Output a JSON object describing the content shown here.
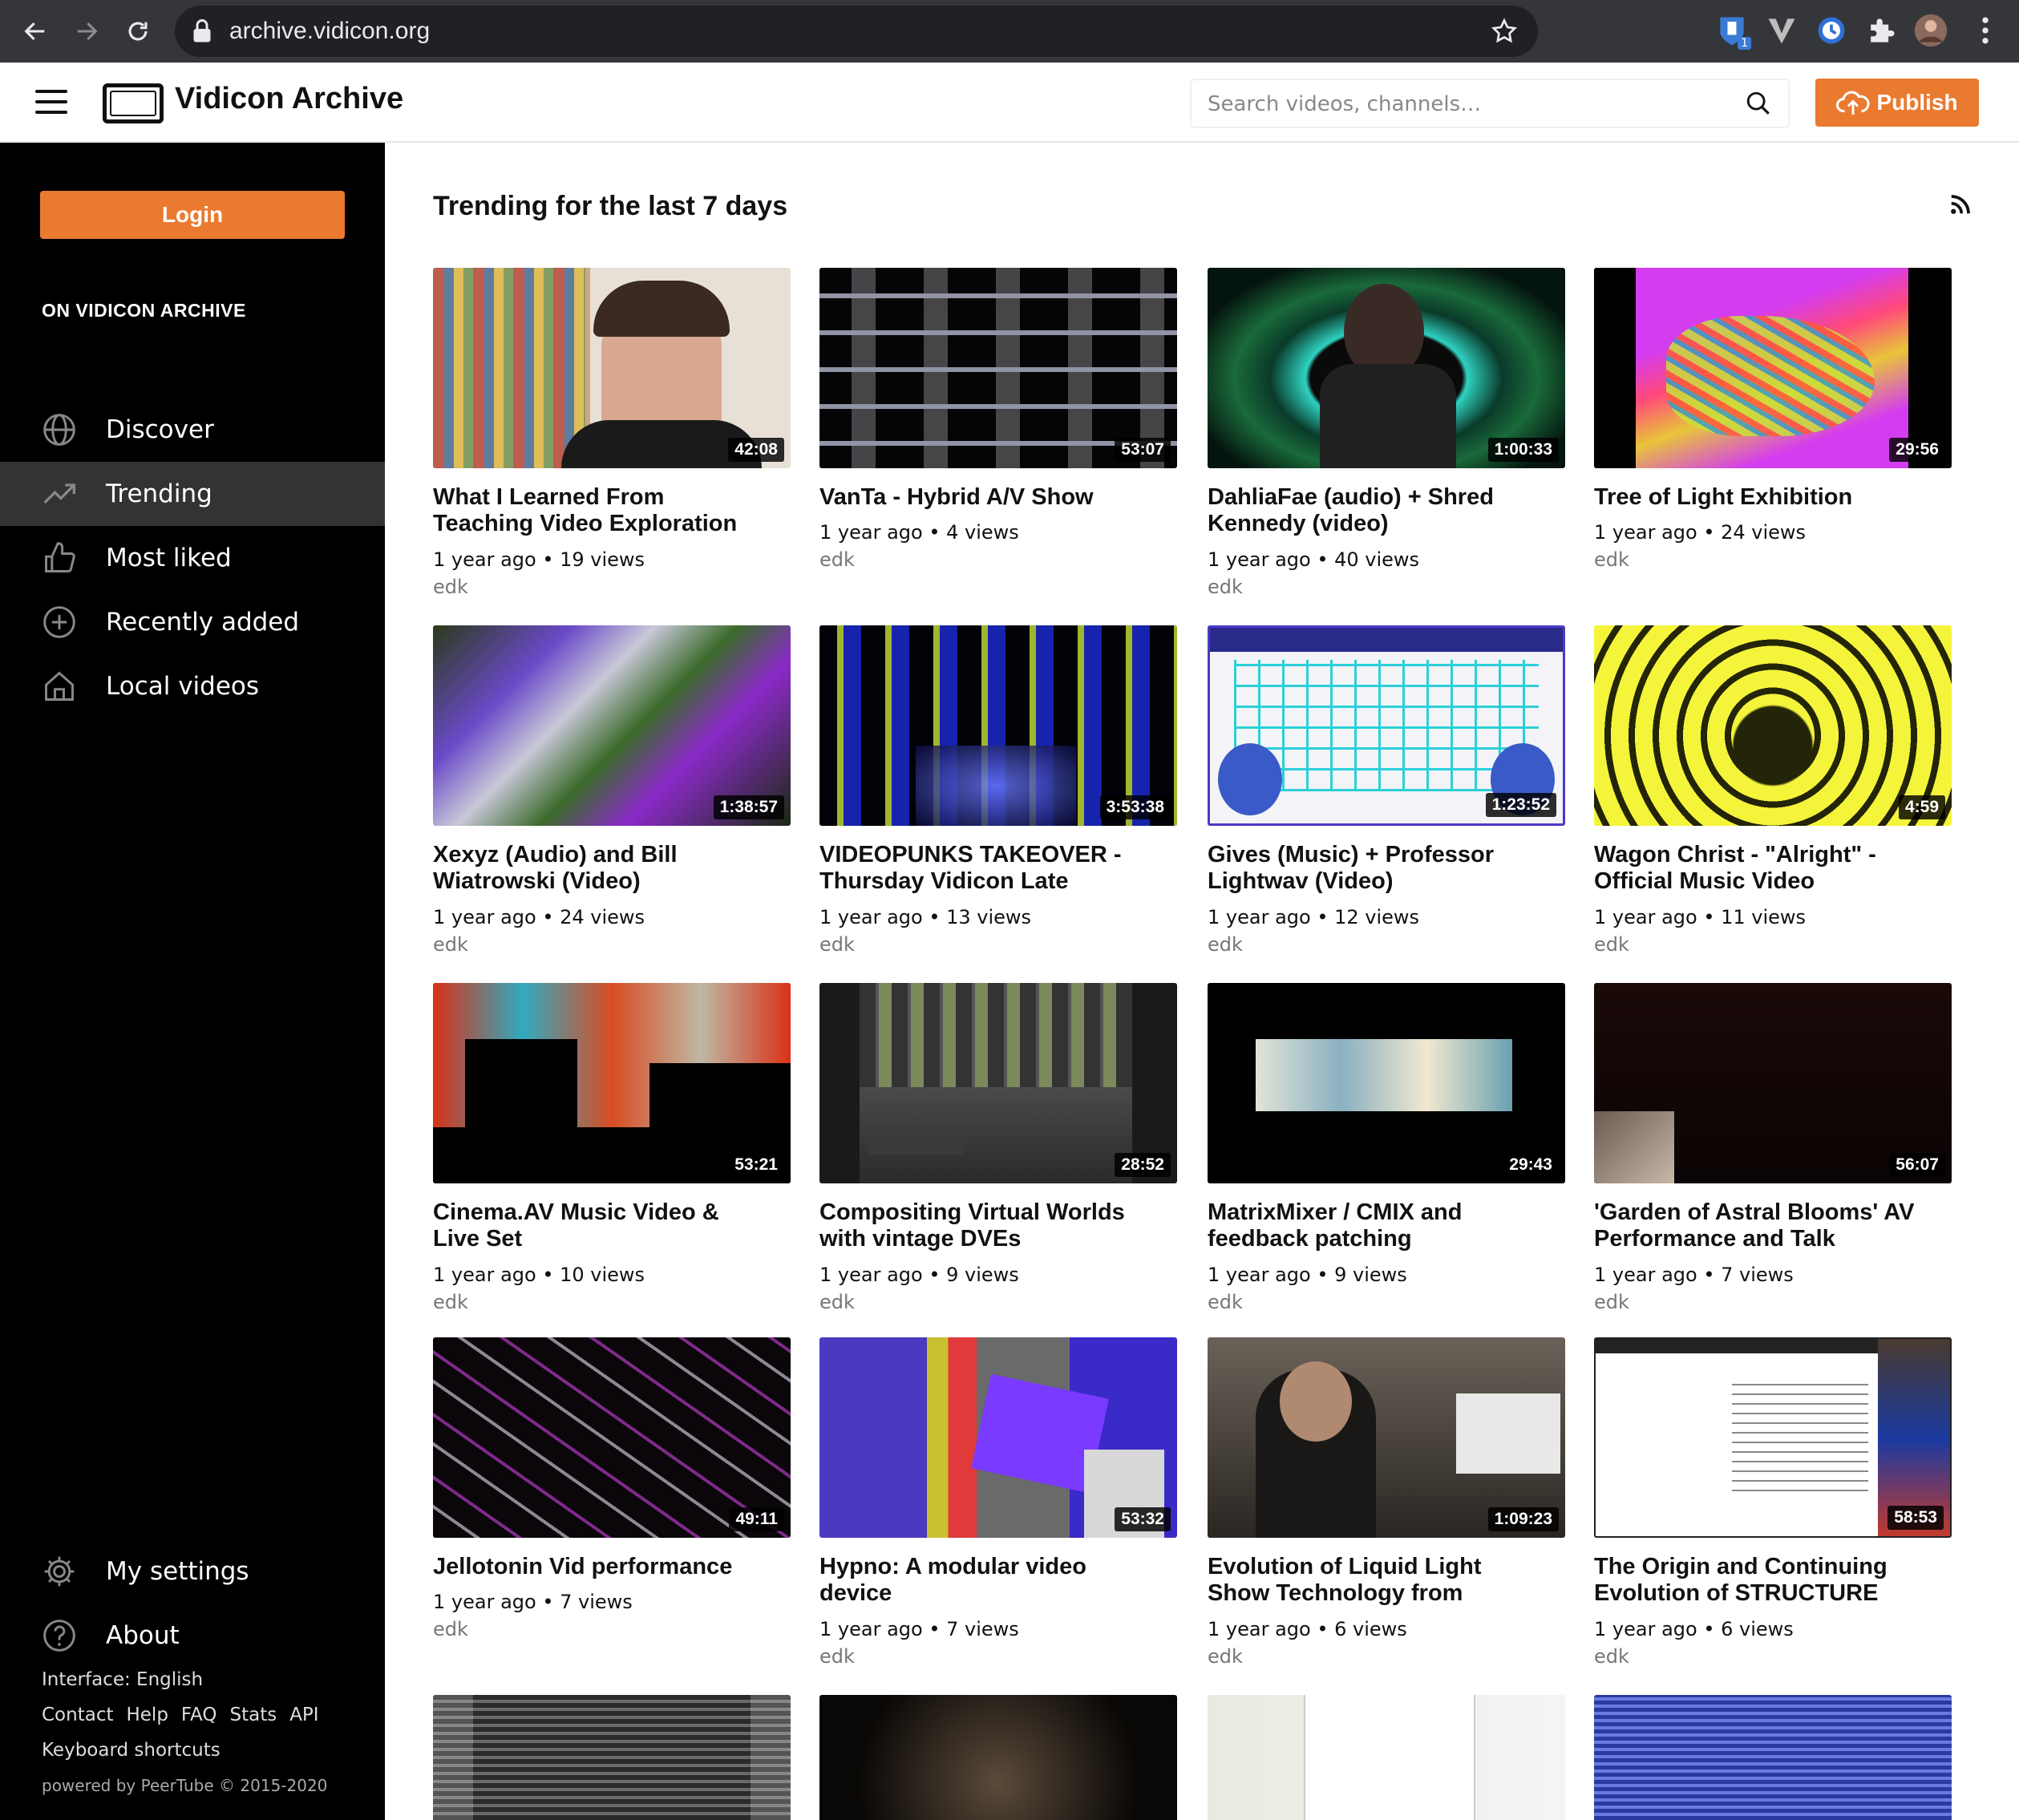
{
  "browser": {
    "url": "archive.vidicon.org",
    "extension_badge": "1"
  },
  "header": {
    "site_title": "Vidicon Archive",
    "search_placeholder": "Search videos, channels…",
    "publish_label": "Publish"
  },
  "sidebar": {
    "login_label": "Login",
    "section_title": "ON VIDICON ARCHIVE",
    "items": [
      {
        "label": "Discover",
        "icon": "globe-icon"
      },
      {
        "label": "Trending",
        "icon": "trending-icon",
        "active": true
      },
      {
        "label": "Most liked",
        "icon": "thumbs-up-icon"
      },
      {
        "label": "Recently added",
        "icon": "plus-circle-icon"
      },
      {
        "label": "Local videos",
        "icon": "home-icon"
      }
    ],
    "settings_label": "My settings",
    "about_label": "About",
    "footer": {
      "interface": "Interface: English",
      "links": [
        "Contact",
        "Help",
        "FAQ",
        "Stats",
        "API"
      ],
      "shortcuts": "Keyboard shortcuts",
      "powered": "powered by PeerTube",
      "copyright": "© 2015-2020"
    }
  },
  "main": {
    "title": "Trending for the last 7 days",
    "videos": [
      {
        "title": "What I Learned From Teaching Video Exploration",
        "duration": "42:08",
        "age": "1 year ago",
        "views": "19 views",
        "channel": "edk"
      },
      {
        "title": "VanTa - Hybrid A/V Show",
        "duration": "53:07",
        "age": "1 year ago",
        "views": "4 views",
        "channel": "edk"
      },
      {
        "title": "DahliaFae (audio) + Shred Kennedy (video)",
        "duration": "1:00:33",
        "age": "1 year ago",
        "views": "40 views",
        "channel": "edk"
      },
      {
        "title": "Tree of Light Exhibition",
        "duration": "29:56",
        "age": "1 year ago",
        "views": "24 views",
        "channel": "edk"
      },
      {
        "title": "Xexyz (Audio) and Bill Wiatrowski (Video)",
        "duration": "1:38:57",
        "age": "1 year ago",
        "views": "24 views",
        "channel": "edk"
      },
      {
        "title": "VIDEOPUNKS TAKEOVER - Thursday Vidicon Late",
        "duration": "3:53:38",
        "age": "1 year ago",
        "views": "13 views",
        "channel": "edk"
      },
      {
        "title": "Gives (Music) + Professor Lightwav (Video)",
        "duration": "1:23:52",
        "age": "1 year ago",
        "views": "12 views",
        "channel": "edk"
      },
      {
        "title": "Wagon Christ - \"Alright\" - Official Music Video",
        "duration": "4:59",
        "age": "1 year ago",
        "views": "11 views",
        "channel": "edk"
      },
      {
        "title": "Cinema.AV Music Video & Live Set",
        "duration": "53:21",
        "age": "1 year ago",
        "views": "10 views",
        "channel": "edk"
      },
      {
        "title": "Compositing Virtual Worlds with vintage DVEs",
        "duration": "28:52",
        "age": "1 year ago",
        "views": "9 views",
        "channel": "edk"
      },
      {
        "title": "MatrixMixer / CMIX and feedback patching",
        "duration": "29:43",
        "age": "1 year ago",
        "views": "9 views",
        "channel": "edk"
      },
      {
        "title": "'Garden of Astral Blooms' AV Performance and Talk",
        "duration": "56:07",
        "age": "1 year ago",
        "views": "7 views",
        "channel": "edk"
      },
      {
        "title": "Jellotonin Vid performance",
        "duration": "49:11",
        "age": "1 year ago",
        "views": "7 views",
        "channel": "edk"
      },
      {
        "title": "Hypno: A modular video device",
        "duration": "53:32",
        "age": "1 year ago",
        "views": "7 views",
        "channel": "edk"
      },
      {
        "title": "Evolution of Liquid Light Show Technology from",
        "duration": "1:09:23",
        "age": "1 year ago",
        "views": "6 views",
        "channel": "edk"
      },
      {
        "title": "The Origin and Continuing Evolution of STRUCTURE",
        "duration": "58:53",
        "age": "1 year ago",
        "views": "6 views",
        "channel": "edk"
      }
    ]
  },
  "colors": {
    "accent": "#ea7a30",
    "sidebar_bg": "#000000",
    "sidebar_active": "#333333"
  }
}
